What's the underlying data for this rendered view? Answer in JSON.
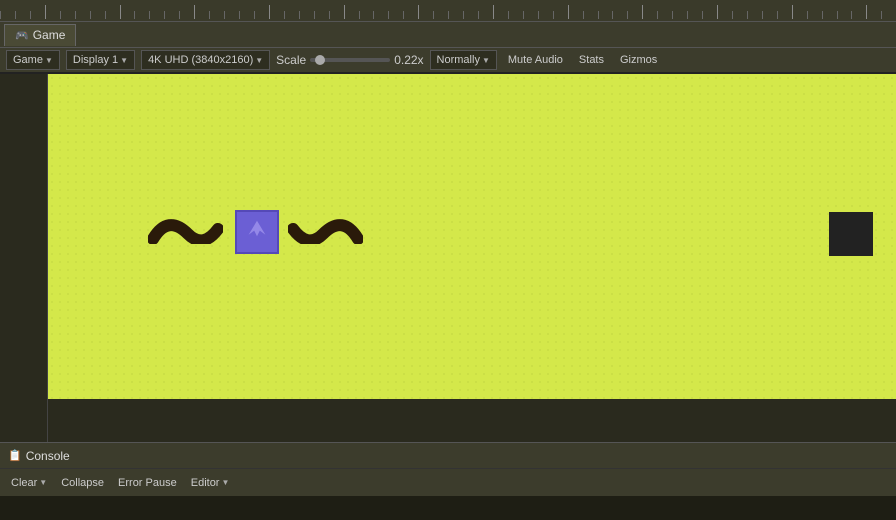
{
  "ruler": {
    "tick_count": 60
  },
  "game_tab": {
    "icon": "🎮",
    "label": "Game"
  },
  "toolbar": {
    "game_label": "Game",
    "display_label": "Display 1",
    "resolution_label": "4K UHD (3840x2160)",
    "scale_label": "Scale",
    "scale_value": "0.22x",
    "render_mode_label": "Normally",
    "mute_audio_label": "Mute Audio",
    "stats_label": "Stats",
    "gizmos_label": "Gizmos"
  },
  "console": {
    "icon": "📋",
    "label": "Console",
    "clear_label": "Clear",
    "collapse_label": "Collapse",
    "error_pause_label": "Error Pause",
    "editor_label": "Editor"
  },
  "colors": {
    "viewport_bg": "#d4e84a",
    "player_bg": "#6b5fd4",
    "black_square": "#222"
  }
}
